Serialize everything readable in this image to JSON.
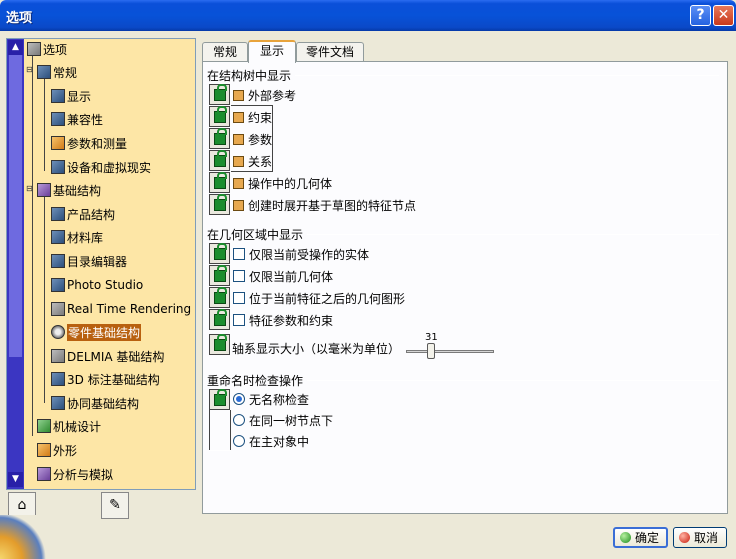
{
  "window": {
    "title": "选项"
  },
  "titlebar": {
    "help_glyph": "?",
    "close_glyph": "✕"
  },
  "tree": {
    "items": [
      {
        "label": "选项",
        "icon": "options-root-icon"
      },
      {
        "label": "常规",
        "icon": "general-icon"
      },
      {
        "label": "显示",
        "icon": "display-icon"
      },
      {
        "label": "兼容性",
        "icon": "compatibility-icon"
      },
      {
        "label": "参数和测量",
        "icon": "parameters-measure-icon"
      },
      {
        "label": "设备和虚拟现实",
        "icon": "devices-vr-icon"
      },
      {
        "label": "基础结构",
        "icon": "infrastructure-icon"
      },
      {
        "label": "产品结构",
        "icon": "product-structure-icon"
      },
      {
        "label": "材料库",
        "icon": "material-library-icon"
      },
      {
        "label": "目录编辑器",
        "icon": "catalog-editor-icon"
      },
      {
        "label": "Photo Studio",
        "icon": "photo-studio-icon"
      },
      {
        "label": "Real Time Rendering",
        "icon": "real-time-rendering-icon"
      },
      {
        "label": "零件基础结构",
        "icon": "part-infrastructure-icon"
      },
      {
        "label": "DELMIA 基础结构",
        "icon": "delmia-icon"
      },
      {
        "label": "3D 标注基础结构",
        "icon": "3d-annotation-icon"
      },
      {
        "label": "协同基础结构",
        "icon": "collaboration-icon"
      },
      {
        "label": "机械设计",
        "icon": "mechanical-design-icon"
      },
      {
        "label": "外形",
        "icon": "shape-icon"
      },
      {
        "label": "分析与模拟",
        "icon": "analysis-simulation-icon"
      }
    ],
    "selected": "零件基础结构",
    "scroll_up": "▲",
    "scroll_down": "▼"
  },
  "tabs": [
    {
      "label": "常规"
    },
    {
      "label": "显示"
    },
    {
      "label": "零件文档"
    }
  ],
  "active_tab": "显示",
  "sections": {
    "tree_display": {
      "title": "在结构树中显示",
      "options": [
        {
          "label": "外部参考",
          "checked": true
        },
        {
          "label": "约束",
          "checked": true
        },
        {
          "label": "参数",
          "checked": true
        },
        {
          "label": "关系",
          "checked": true
        },
        {
          "label": "操作中的几何体",
          "checked": true
        },
        {
          "label": "创建时展开基于草图的特征节点",
          "checked": true
        }
      ]
    },
    "geometry_display": {
      "title": "在几何区域中显示",
      "options": [
        {
          "label": "仅限当前受操作的实体",
          "checked": false
        },
        {
          "label": "仅限当前几何体",
          "checked": false
        },
        {
          "label": "位于当前特征之后的几何图形",
          "checked": false
        },
        {
          "label": "特征参数和约束",
          "checked": false
        }
      ],
      "axis_size_label": "轴系显示大小（以毫米为单位）",
      "axis_size_value": "31"
    },
    "rename_check": {
      "title": "重命名时检查操作",
      "options": [
        {
          "label": "无名称检查",
          "selected": true
        },
        {
          "label": "在同一树节点下",
          "selected": false
        },
        {
          "label": "在主对象中",
          "selected": false
        }
      ]
    }
  },
  "buttons": {
    "ok": "确定",
    "cancel": "取消"
  },
  "colors": {
    "title_bar": "#0852d8",
    "tree_bg": "#fde6a6",
    "scrollbar": "#3b36c2",
    "selection": "#b8600f",
    "checkbox_checked": "#e7a84f",
    "tab_highlight": "#e8a33b"
  }
}
